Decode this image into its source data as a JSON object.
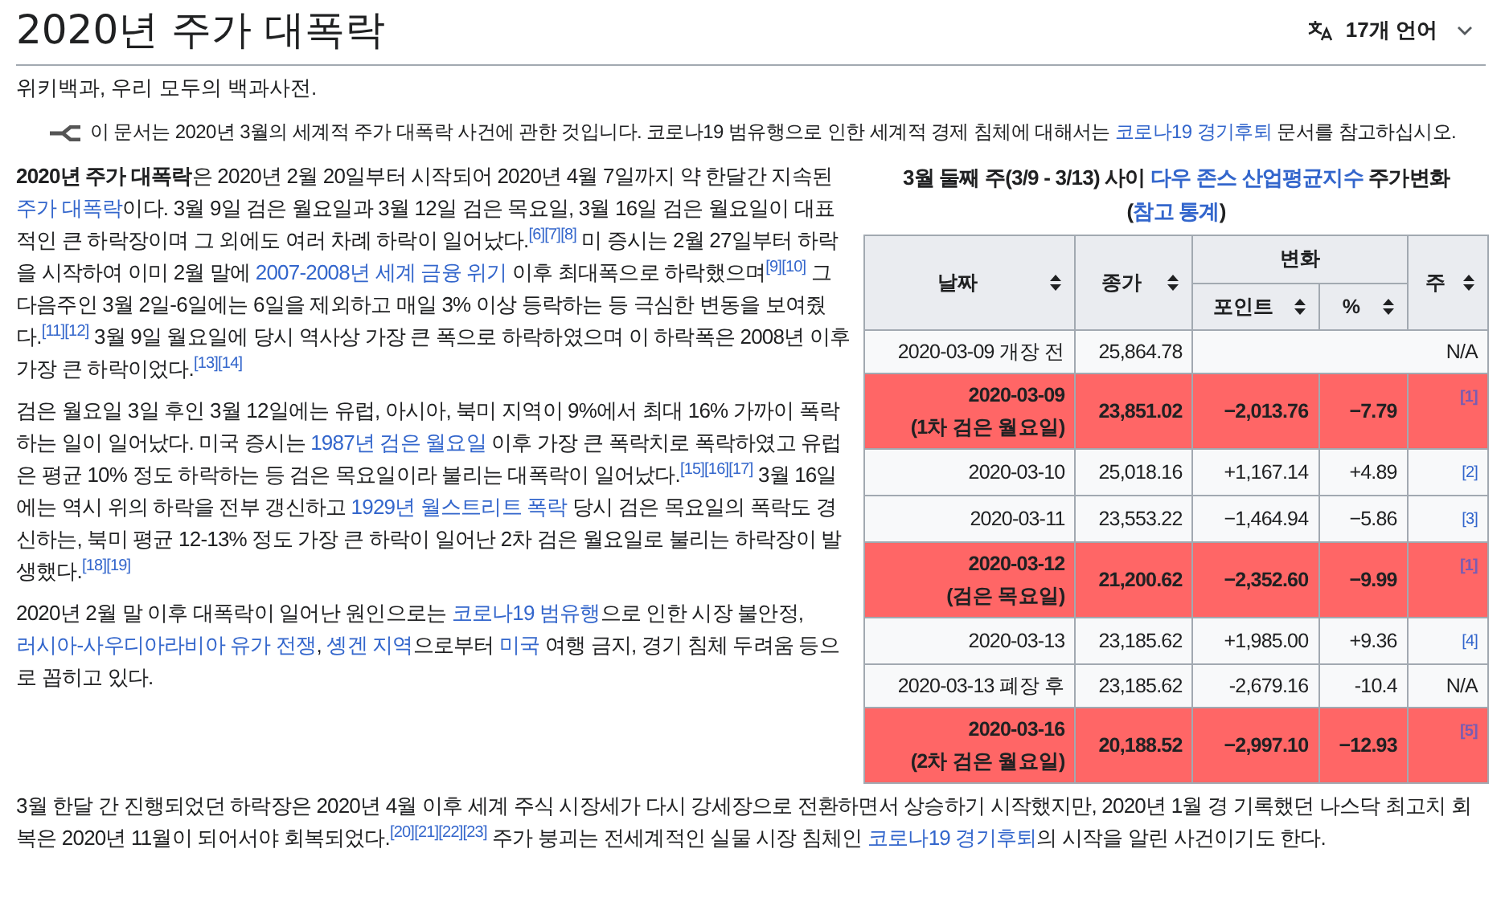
{
  "title": "2020년 주가 대폭락",
  "language_button": {
    "label": "17개 언어"
  },
  "tagline": "위키백과, 우리 모두의 백과사전.",
  "hatnote": [
    {
      "kind": "text",
      "t": "이 문서는 2020년 3월의 세계적 주가 대폭락 사건에 관한 것입니다. 코로나19 범유행으로 인한 세계적 경제 침체에 대해서는 "
    },
    {
      "kind": "link",
      "t": "코로나19 경기후퇴"
    },
    {
      "kind": "text",
      "t": " 문서를 참고하십시오."
    }
  ],
  "table": {
    "caption": [
      {
        "kind": "text",
        "t": "3월 둘째 주(3/9 - 3/13) 사이 "
      },
      {
        "kind": "link",
        "t": "다우 존스 산업평균지수"
      },
      {
        "kind": "text",
        "t": " 주가변화 ("
      },
      {
        "kind": "link",
        "t": "참고 통계"
      },
      {
        "kind": "text",
        "t": ")"
      }
    ],
    "columns": {
      "date": "날짜",
      "close": "종가",
      "change": "변화",
      "points": "포인트",
      "pct": "%",
      "note": "주"
    },
    "rows": [
      {
        "date": "2020-03-09 개장 전",
        "close": "25,864.78",
        "note": "N/A",
        "kind": "plain",
        "highlighted": false
      },
      {
        "date": "2020-03-09",
        "subtitle": "(1차 검은 월요일)",
        "close": "23,851.02",
        "points": "−2,013.76",
        "pct": "−7.79",
        "note": "[1]",
        "kind": "reference",
        "visited": true,
        "highlighted": true
      },
      {
        "date": "2020-03-10",
        "close": "25,018.16",
        "points": "+1,167.14",
        "pct": "+4.89",
        "note": "[2]",
        "kind": "reference",
        "visited": false,
        "highlighted": false
      },
      {
        "date": "2020-03-11",
        "close": "23,553.22",
        "points": "−1,464.94",
        "pct": "−5.86",
        "note": "[3]",
        "kind": "reference",
        "visited": false,
        "highlighted": false
      },
      {
        "date": "2020-03-12",
        "subtitle": "(검은 목요일)",
        "close": "21,200.62",
        "points": "−2,352.60",
        "pct": "−9.99",
        "note": "[1]",
        "kind": "reference",
        "visited": true,
        "highlighted": true
      },
      {
        "date": "2020-03-13",
        "close": "23,185.62",
        "points": "+1,985.00",
        "pct": "+9.36",
        "note": "[4]",
        "kind": "reference",
        "visited": false,
        "highlighted": false
      },
      {
        "date": "2020-03-13 폐장 후",
        "close": "23,185.62",
        "points": "-2,679.16",
        "pct": "-10.4",
        "note": "N/A",
        "kind": "plain",
        "highlighted": false
      },
      {
        "date": "2020-03-16",
        "subtitle": "(2차 검은 월요일)",
        "close": "20,188.52",
        "points": "−2,997.10",
        "pct": "−12.93",
        "note": "[5]",
        "kind": "reference",
        "visited": true,
        "highlighted": true
      }
    ]
  },
  "paragraphs": [
    [
      {
        "kind": "bold",
        "t": "2020년 주가 대폭락"
      },
      {
        "kind": "text",
        "t": "은 2020년 2월 20일부터 시작되어 2020년 4월 7일까지 약 한달간 지속된 "
      },
      {
        "kind": "link",
        "t": "주가 대폭락"
      },
      {
        "kind": "text",
        "t": "이다. 3월 9일 검은 월요일과 3월 12일 검은 목요일, 3월 16일 검은 월요일이 대표적인 큰 하락장이며 그 외에도 여러 차례 하락이 일어났다."
      },
      {
        "kind": "ref",
        "t": "[6]"
      },
      {
        "kind": "ref",
        "t": "[7]"
      },
      {
        "kind": "ref",
        "t": "[8]"
      },
      {
        "kind": "text",
        "t": " 미 증시는 2월 27일부터 하락을 시작하여 이미 2월 말에 "
      },
      {
        "kind": "link",
        "t": "2007-2008년 세계 금융 위기"
      },
      {
        "kind": "text",
        "t": " 이후 최대폭으로 하락했으며"
      },
      {
        "kind": "ref",
        "t": "[9]"
      },
      {
        "kind": "ref",
        "t": "[10]"
      },
      {
        "kind": "text",
        "t": " 그 다음주인 3월 2일-6일에는 6일을 제외하고 매일 3% 이상 등락하는 등 극심한 변동을 보여줬다."
      },
      {
        "kind": "ref",
        "t": "[11]"
      },
      {
        "kind": "ref",
        "t": "[12]"
      },
      {
        "kind": "text",
        "t": " 3월 9일 월요일에 당시 역사상 가장 큰 폭으로 하락하였으며 이 하락폭은 2008년 이후 가장 큰 하락이었다."
      },
      {
        "kind": "ref",
        "t": "[13]"
      },
      {
        "kind": "ref",
        "t": "[14]"
      }
    ],
    [
      {
        "kind": "text",
        "t": "검은 월요일 3일 후인 3월 12일에는 유럽, 아시아, 북미 지역이 9%에서 최대 16% 가까이 폭락하는 일이 일어났다. 미국 증시는 "
      },
      {
        "kind": "link",
        "t": "1987년 검은 월요일"
      },
      {
        "kind": "text",
        "t": " 이후 가장 큰 폭락치로 폭락하였고 유럽은 평균 10% 정도 하락하는 등 검은 목요일이라 불리는 대폭락이 일어났다."
      },
      {
        "kind": "ref",
        "t": "[15]"
      },
      {
        "kind": "ref",
        "t": "[16]"
      },
      {
        "kind": "ref",
        "t": "[17]"
      },
      {
        "kind": "text",
        "t": " 3월 16일에는 역시 위의 하락을 전부 갱신하고 "
      },
      {
        "kind": "link",
        "t": "1929년 월스트리트 폭락"
      },
      {
        "kind": "text",
        "t": " 당시 검은 목요일의 폭락도 경신하는, 북미 평균 12-13% 정도 가장 큰 하락이 일어난 2차 검은 월요일로 불리는 하락장이 발생했다."
      },
      {
        "kind": "ref",
        "t": "[18]"
      },
      {
        "kind": "ref",
        "t": "[19]"
      }
    ],
    [
      {
        "kind": "text",
        "t": "2020년 2월 말 이후 대폭락이 일어난 원인으로는 "
      },
      {
        "kind": "link",
        "t": "코로나19 범유행"
      },
      {
        "kind": "text",
        "t": "으로 인한 시장 불안정, "
      },
      {
        "kind": "link",
        "t": "러시아-사우디아라비아 유가 전쟁"
      },
      {
        "kind": "text",
        "t": ", "
      },
      {
        "kind": "link",
        "t": "솅겐 지역"
      },
      {
        "kind": "text",
        "t": "으로부터 "
      },
      {
        "kind": "link",
        "t": "미국"
      },
      {
        "kind": "text",
        "t": " 여행 금지, 경기 침체 두려움 등으로 꼽히고 있다."
      }
    ],
    [
      {
        "kind": "text",
        "t": "3월 한달 간 진행되었던 하락장은 2020년 4월 이후 세계 주식 시장세가 다시 강세장으로 전환하면서 상승하기 시작했지만, 2020년 1월 경 기록했던 나스닥 최고치 회복은 2020년 11월이 되어서야 회복되었다."
      },
      {
        "kind": "ref",
        "t": "[20]"
      },
      {
        "kind": "ref",
        "t": "[21]"
      },
      {
        "kind": "ref",
        "t": "[22]"
      },
      {
        "kind": "ref",
        "t": "[23]"
      },
      {
        "kind": "text",
        "t": " 주가 붕괴는 전세계적인 실물 시장 침체인 "
      },
      {
        "kind": "link",
        "t": "코로나19 경기후퇴"
      },
      {
        "kind": "text",
        "t": "의 시작을 알린 사건이기도 한다."
      }
    ]
  ]
}
